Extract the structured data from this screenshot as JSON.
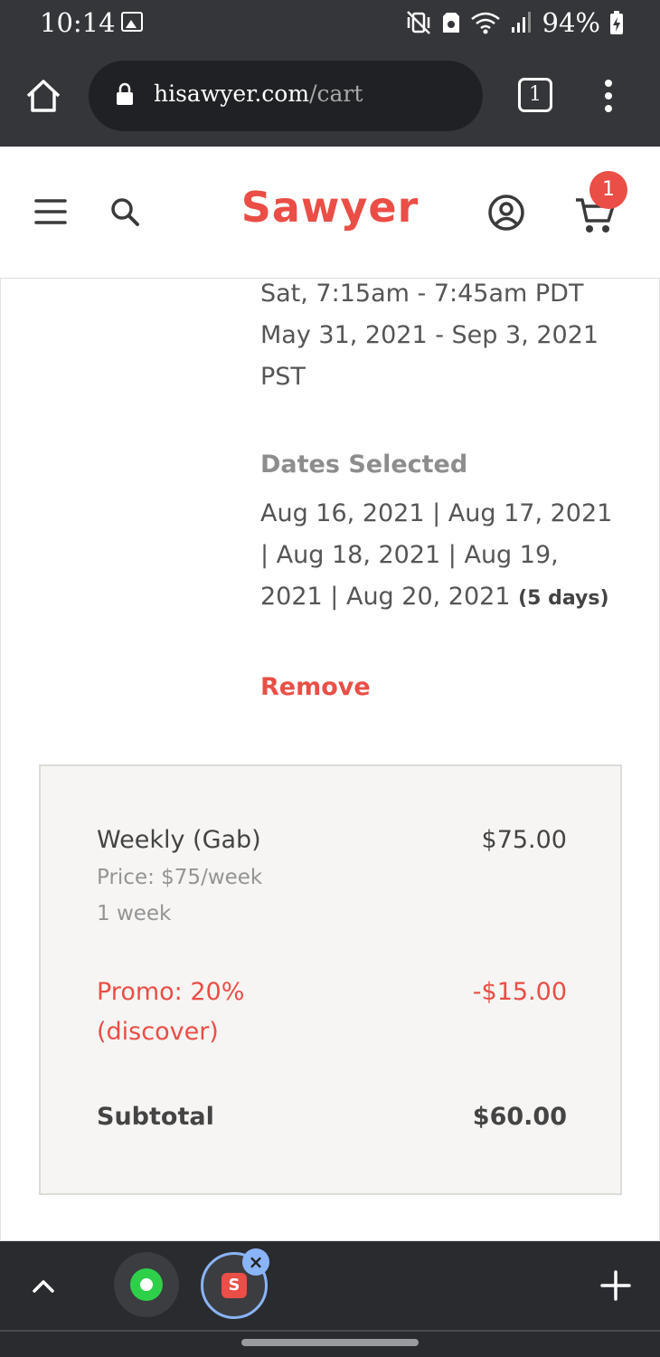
{
  "status_bar": {
    "time": "10:14",
    "battery": "94%"
  },
  "browser": {
    "url_domain": "hisawyer.com",
    "url_path": "/cart",
    "tab_count": "1"
  },
  "header": {
    "logo": "Sawyer",
    "cart_count": "1"
  },
  "schedule": {
    "time_line": "Sat, 7:15am - 7:45am PDT",
    "range_line": "May 31, 2021 - Sep 3, 2021",
    "tz_line": "PST"
  },
  "dates": {
    "label": "Dates Selected",
    "line1": "Aug 16, 2021 | Aug 17, 2021",
    "line2": "| Aug 18, 2021 | Aug 19,",
    "line3": "2021 | Aug 20, 2021",
    "days": "(5 days)"
  },
  "remove_label": "Remove",
  "summary": {
    "item_name": "Weekly (Gab)",
    "item_price": "$75.00",
    "price_note": "Price: $75/week",
    "duration": "1 week",
    "promo_line1": "Promo: 20%",
    "promo_line2": "(discover)",
    "promo_amount": "-$15.00",
    "subtotal_label": "Subtotal",
    "subtotal_value": "$60.00"
  },
  "bottom_bar": {
    "sawyer_tile": "S",
    "close_glyph": "×"
  },
  "colors": {
    "brand": "#ea4e46",
    "chrome_dark": "#35363a"
  }
}
